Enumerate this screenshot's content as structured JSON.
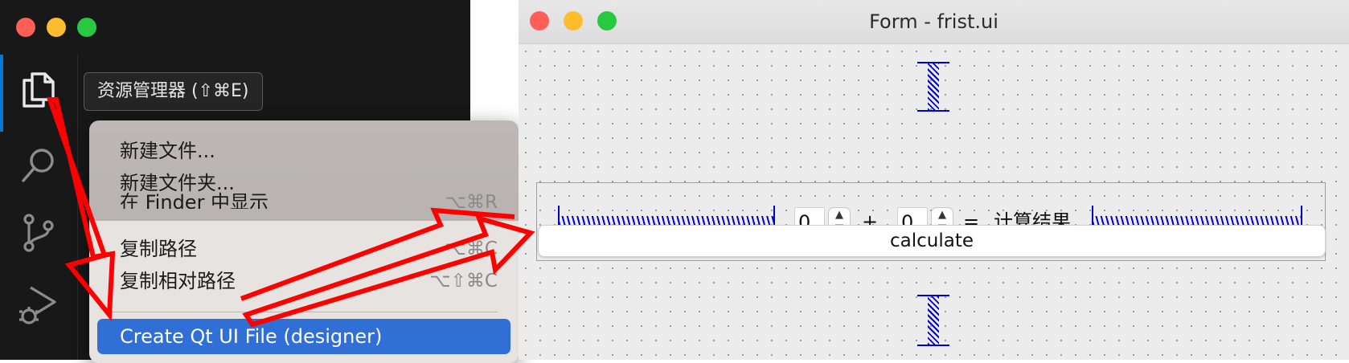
{
  "vscode": {
    "traffic_lights": [
      "close",
      "minimize",
      "zoom"
    ],
    "activity_bar": {
      "items": [
        {
          "icon": "explorer-files-icon",
          "active": true
        },
        {
          "icon": "search-icon",
          "active": false
        },
        {
          "icon": "source-control-icon",
          "active": false
        },
        {
          "icon": "run-debug-icon",
          "active": false
        }
      ],
      "accent_color": "#0078d4"
    },
    "tooltip": "资源管理器 (⇧⌘E)"
  },
  "context_menu": {
    "items": [
      {
        "label": "新建文件...",
        "shortcut": ""
      },
      {
        "label": "新建文件夹...",
        "shortcut": ""
      },
      {
        "label": "在 Finder 中显示",
        "shortcut": "⌥⌘R"
      },
      {
        "label": "复制路径",
        "shortcut": "⌥⌘C"
      },
      {
        "label": "复制相对路径",
        "shortcut": "⌥⇧⌘C"
      },
      {
        "label": "Create Qt UI File (designer)",
        "shortcut": "",
        "selected": true
      }
    ],
    "highlight_color": "#2f6fd6"
  },
  "form_window": {
    "title": "Form - frist.ui",
    "spin_a": "0",
    "spin_b": "0",
    "plus": "+",
    "equals": "=",
    "result_label": "计算结果",
    "button_label": "calculate"
  },
  "annotations": {
    "arrow_color": "#ff0000",
    "arrow_count": 2
  }
}
